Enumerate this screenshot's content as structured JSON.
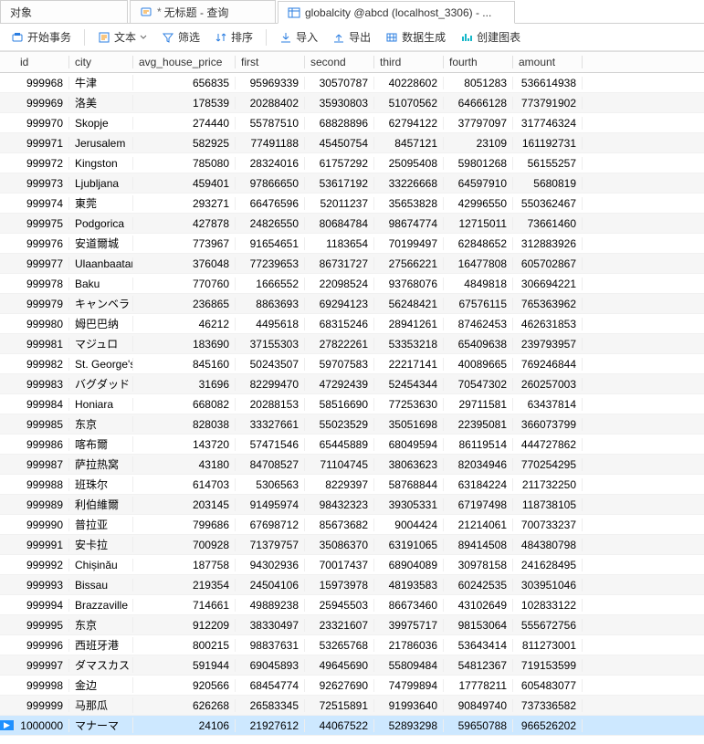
{
  "tabs": {
    "t0_label": "对象",
    "t1_star": "*",
    "t1_label": "无标题 - 查询",
    "t2_label": "globalcity @abcd (localhost_3306) - ..."
  },
  "toolbar": {
    "begin_tx": "开始事务",
    "text": "文本",
    "filter": "筛选",
    "sort": "排序",
    "import": "导入",
    "export": "导出",
    "datagen": "数据生成",
    "chart": "创建图表"
  },
  "columns": {
    "id": "id",
    "city": "city",
    "price": "avg_house_price",
    "first": "first",
    "second": "second",
    "third": "third",
    "fourth": "fourth",
    "amount": "amount"
  },
  "rows": [
    {
      "id": 999968,
      "city": "牛津",
      "price": 656835,
      "first": 95969339,
      "second": 30570787,
      "third": 40228602,
      "fourth": 8051283,
      "amount": 536614938
    },
    {
      "id": 999969,
      "city": "洛美",
      "price": 178539,
      "first": 20288402,
      "second": 35930803,
      "third": 51070562,
      "fourth": 64666128,
      "amount": 773791902
    },
    {
      "id": 999970,
      "city": "Skopje",
      "price": 274440,
      "first": 55787510,
      "second": 68828896,
      "third": 62794122,
      "fourth": 37797097,
      "amount": 317746324
    },
    {
      "id": 999971,
      "city": "Jerusalem",
      "price": 582925,
      "first": 77491188,
      "second": 45450754,
      "third": 8457121,
      "fourth": 23109,
      "amount": 161192731
    },
    {
      "id": 999972,
      "city": "Kingston",
      "price": 785080,
      "first": 28324016,
      "second": 61757292,
      "third": 25095408,
      "fourth": 59801268,
      "amount": 56155257
    },
    {
      "id": 999973,
      "city": "Ljubljana",
      "price": 459401,
      "first": 97866650,
      "second": 53617192,
      "third": 33226668,
      "fourth": 64597910,
      "amount": 5680819
    },
    {
      "id": 999974,
      "city": "東莞",
      "price": 293271,
      "first": 66476596,
      "second": 52011237,
      "third": 35653828,
      "fourth": 42996550,
      "amount": 550362467
    },
    {
      "id": 999975,
      "city": "Podgorica",
      "price": 427878,
      "first": 24826550,
      "second": 80684784,
      "third": 98674774,
      "fourth": 12715011,
      "amount": 73661460
    },
    {
      "id": 999976,
      "city": "安道爾城",
      "price": 773967,
      "first": 91654651,
      "second": 1183654,
      "third": 70199497,
      "fourth": 62848652,
      "amount": 312883926
    },
    {
      "id": 999977,
      "city": "Ulaanbaatar",
      "price": 376048,
      "first": 77239653,
      "second": 86731727,
      "third": 27566221,
      "fourth": 16477808,
      "amount": 605702867
    },
    {
      "id": 999978,
      "city": "Baku",
      "price": 770760,
      "first": 1666552,
      "second": 22098524,
      "third": 93768076,
      "fourth": 4849818,
      "amount": 306694221
    },
    {
      "id": 999979,
      "city": "キャンベラ",
      "price": 236865,
      "first": 8863693,
      "second": 69294123,
      "third": 56248421,
      "fourth": 67576115,
      "amount": 765363962
    },
    {
      "id": 999980,
      "city": "姆巴巴纳",
      "price": 46212,
      "first": 4495618,
      "second": 68315246,
      "third": 28941261,
      "fourth": 87462453,
      "amount": 462631853
    },
    {
      "id": 999981,
      "city": "マジュロ",
      "price": 183690,
      "first": 37155303,
      "second": 27822261,
      "third": 53353218,
      "fourth": 65409638,
      "amount": 239793957
    },
    {
      "id": 999982,
      "city": "St. George's",
      "price": 845160,
      "first": 50243507,
      "second": 59707583,
      "third": 22217141,
      "fourth": 40089665,
      "amount": 769246844
    },
    {
      "id": 999983,
      "city": "バグダッド",
      "price": 31696,
      "first": 82299470,
      "second": 47292439,
      "third": 52454344,
      "fourth": 70547302,
      "amount": 260257003
    },
    {
      "id": 999984,
      "city": "Honiara",
      "price": 668082,
      "first": 20288153,
      "second": 58516690,
      "third": 77253630,
      "fourth": 29711581,
      "amount": 63437814
    },
    {
      "id": 999985,
      "city": "东京",
      "price": 828038,
      "first": 33327661,
      "second": 55023529,
      "third": 35051698,
      "fourth": 22395081,
      "amount": 366073799
    },
    {
      "id": 999986,
      "city": "喀布爾",
      "price": 143720,
      "first": 57471546,
      "second": 65445889,
      "third": 68049594,
      "fourth": 86119514,
      "amount": 444727862
    },
    {
      "id": 999987,
      "city": "萨拉热窝",
      "price": 43180,
      "first": 84708527,
      "second": 71104745,
      "third": 38063623,
      "fourth": 82034946,
      "amount": 770254295
    },
    {
      "id": 999988,
      "city": "班珠尔",
      "price": 614703,
      "first": 5306563,
      "second": 8229397,
      "third": 58768844,
      "fourth": 63184224,
      "amount": 211732250
    },
    {
      "id": 999989,
      "city": "利伯維爾",
      "price": 203145,
      "first": 91495974,
      "second": 98432323,
      "third": 39305331,
      "fourth": 67197498,
      "amount": 118738105
    },
    {
      "id": 999990,
      "city": "普拉亚",
      "price": 799686,
      "first": 67698712,
      "second": 85673682,
      "third": 9004424,
      "fourth": 21214061,
      "amount": 700733237
    },
    {
      "id": 999991,
      "city": "安卡拉",
      "price": 700928,
      "first": 71379757,
      "second": 35086370,
      "third": 63191065,
      "fourth": 89414508,
      "amount": 484380798
    },
    {
      "id": 999992,
      "city": "Chișinău",
      "price": 187758,
      "first": 94302936,
      "second": 70017437,
      "third": 68904089,
      "fourth": 30978158,
      "amount": 241628495
    },
    {
      "id": 999993,
      "city": "Bissau",
      "price": 219354,
      "first": 24504106,
      "second": 15973978,
      "third": 48193583,
      "fourth": 60242535,
      "amount": 303951046
    },
    {
      "id": 999994,
      "city": "Brazzaville",
      "price": 714661,
      "first": 49889238,
      "second": 25945503,
      "third": 86673460,
      "fourth": 43102649,
      "amount": 102833122
    },
    {
      "id": 999995,
      "city": "东京",
      "price": 912209,
      "first": 38330497,
      "second": 23321607,
      "third": 39975717,
      "fourth": 98153064,
      "amount": 555672756
    },
    {
      "id": 999996,
      "city": "西班牙港",
      "price": 800215,
      "first": 98837631,
      "second": 53265768,
      "third": 21786036,
      "fourth": 53643414,
      "amount": 811273001
    },
    {
      "id": 999997,
      "city": "ダマスカス",
      "price": 591944,
      "first": 69045893,
      "second": 49645690,
      "third": 55809484,
      "fourth": 54812367,
      "amount": 719153599
    },
    {
      "id": 999998,
      "city": "金边",
      "price": 920566,
      "first": 68454774,
      "second": 92627690,
      "third": 74799894,
      "fourth": 17778211,
      "amount": 605483077
    },
    {
      "id": 999999,
      "city": "马那瓜",
      "price": 626268,
      "first": 26583345,
      "second": 72515891,
      "third": 91993640,
      "fourth": 90849740,
      "amount": 737336582
    },
    {
      "id": 1000000,
      "city": "マナーマ",
      "price": 24106,
      "first": 21927612,
      "second": 44067522,
      "third": 52893298,
      "fourth": 59650788,
      "amount": 966526202
    }
  ],
  "selected_row_index": 32
}
